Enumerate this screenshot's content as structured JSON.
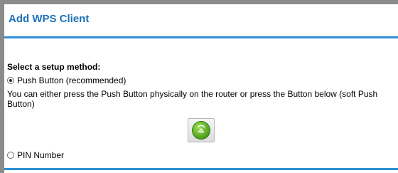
{
  "page": {
    "title": "Add WPS Client"
  },
  "setup": {
    "heading": "Select a setup method:",
    "push_button_option": "Push Button (recommended)",
    "push_button_description": "You can either press the Push Button physically on the router or press the Button below (soft Push Button)",
    "pin_option": "PIN Number",
    "selected_method": "push_button"
  },
  "icons": {
    "wps_button_icon": "wps-push-icon"
  },
  "colors": {
    "title": "#1d71b8",
    "rule": "#2d8fd5",
    "wps_green": "#6cc93a"
  }
}
